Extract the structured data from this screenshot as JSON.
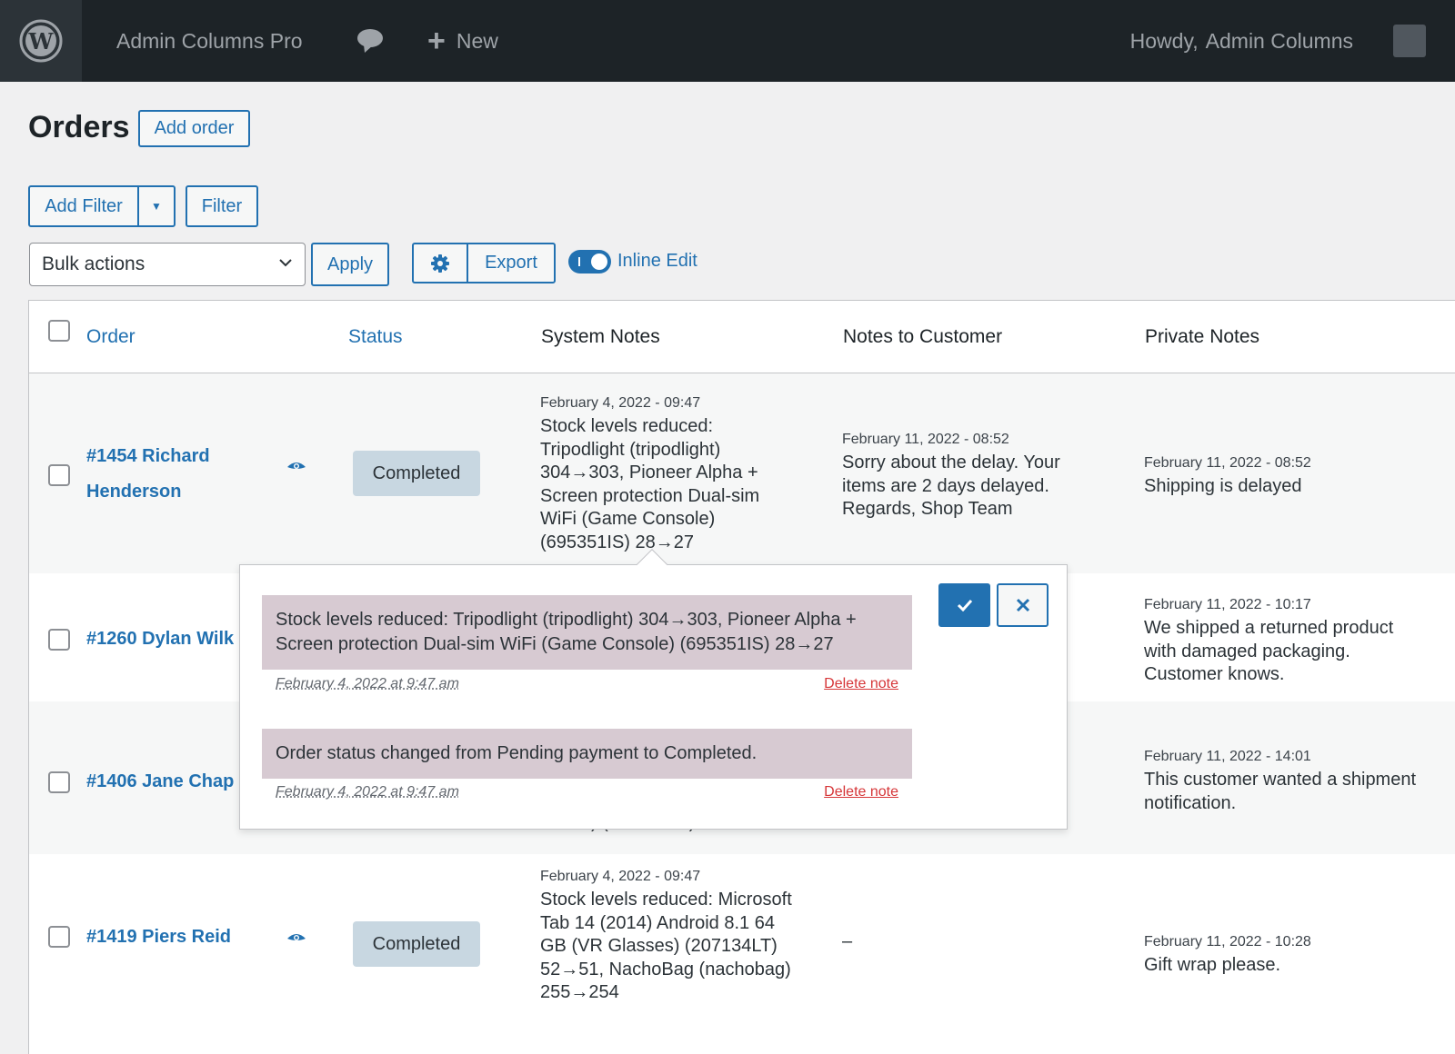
{
  "adminbar": {
    "site_name": "Admin Columns Pro",
    "new_label": "New",
    "howdy": "Howdy,",
    "user": "Admin Columns"
  },
  "header": {
    "title": "Orders",
    "add_order": "Add order"
  },
  "toolbar": {
    "add_filter": "Add Filter",
    "filter": "Filter",
    "bulk_actions": "Bulk actions",
    "apply": "Apply",
    "export": "Export",
    "inline_edit": "Inline Edit"
  },
  "columns": {
    "order": "Order",
    "status": "Status",
    "system_notes": "System Notes",
    "notes_to_customer": "Notes to Customer",
    "private_notes": "Private Notes"
  },
  "rows": [
    {
      "order_line1": "#1454 Richard",
      "order_line2": "Henderson",
      "status": "Completed",
      "system_date": "February 4, 2022 - 09:47",
      "system_lines": [
        "Stock levels reduced:",
        "Tripodlight (tripodlight)",
        "304→303, Pioneer Alpha +",
        "Screen protection Dual-sim",
        "WiFi (Game Console)",
        "(695351IS) 28→27"
      ],
      "customer_date": "February 11, 2022 - 08:52",
      "customer_lines": [
        "Sorry about the delay. Your",
        "items are 2 days delayed.",
        "Regards, Shop Team"
      ],
      "private_date": "February 11, 2022 - 08:52",
      "private_lines": [
        "Shipping is delayed"
      ]
    },
    {
      "order_line1": "#1260 Dylan Wilk",
      "private_date": "February 11, 2022 - 10:17",
      "private_lines": [
        "We shipped a returned product",
        "with damaged packaging.",
        "Customer knows."
      ]
    },
    {
      "order_line1": "#1406 Jane Chap",
      "system_partial": "Watch) (21230 RX) 0→5",
      "private_date": "February 11, 2022 - 14:01",
      "private_lines": [
        "This customer wanted a shipment",
        "notification."
      ]
    },
    {
      "order_line1": "#1419 Piers Reid",
      "status": "Completed",
      "system_date": "February 4, 2022 - 09:47",
      "system_lines": [
        "Stock levels reduced: Microsoft",
        "Tab 14 (2014) Android 8.1 64",
        "GB (VR Glasses) (207134LT)",
        "52→51, NachoBag (nachobag)",
        "255→254"
      ],
      "customer_empty": "–",
      "private_date": "February 11, 2022 - 10:28",
      "private_lines": [
        "Gift wrap please."
      ]
    }
  ],
  "popup": {
    "notes": [
      {
        "lines": [
          "Stock levels reduced: Tripodlight (tripodlight) 304→303, Pioneer Alpha +",
          "Screen protection Dual-sim WiFi (Game Console) (695351IS) 28→27"
        ],
        "when": "February 4, 2022 at 9:47 am",
        "delete": "Delete note"
      },
      {
        "lines": [
          "Order status changed from Pending payment to Completed."
        ],
        "when": "February 4, 2022 at 9:47 am",
        "delete": "Delete note"
      }
    ]
  },
  "colors": {
    "accent": "#2271b1",
    "adminbar": "#1d2327",
    "note_bg": "#d7cad2",
    "status_completed": "#c8d7e1",
    "delete": "#d63638"
  },
  "icons": [
    "wordpress-icon",
    "comment-icon",
    "plus-icon",
    "chevron-down-icon",
    "caret-down-icon",
    "gear-icon",
    "eye-icon",
    "check-icon",
    "close-icon"
  ]
}
